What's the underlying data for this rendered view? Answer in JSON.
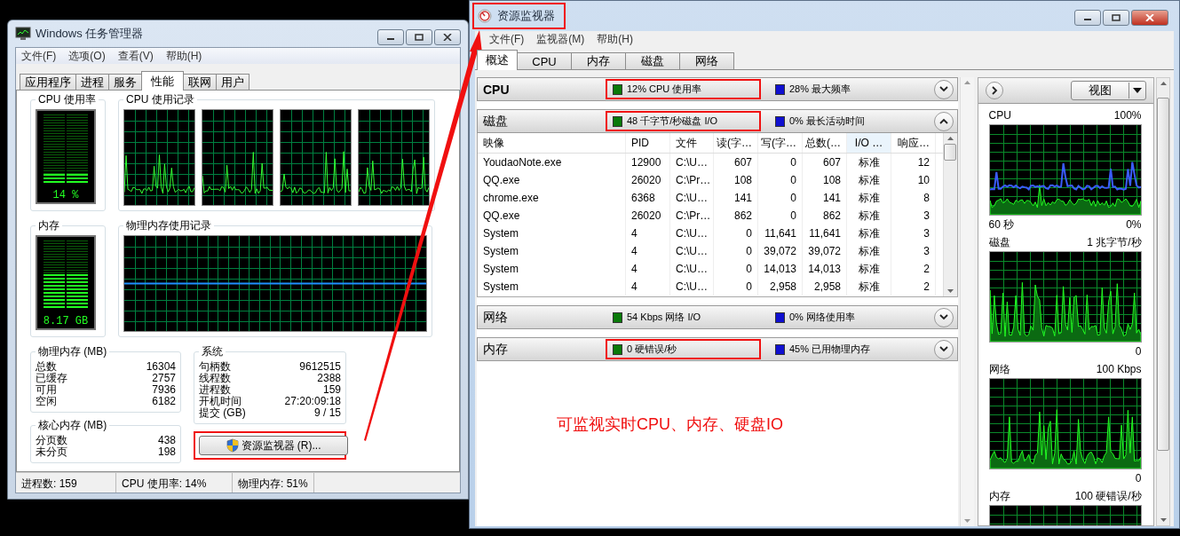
{
  "task_manager": {
    "title": "Windows 任务管理器",
    "menu": [
      "文件(F)",
      "选项(O)",
      "查看(V)",
      "帮助(H)"
    ],
    "tabs": [
      {
        "label": "应用程序",
        "selected": false
      },
      {
        "label": "进程",
        "selected": false
      },
      {
        "label": "服务",
        "selected": false
      },
      {
        "label": "性能",
        "selected": true
      },
      {
        "label": "联网",
        "selected": false
      },
      {
        "label": "用户",
        "selected": false
      }
    ],
    "cpu_usage": {
      "title": "CPU 使用率",
      "reading": "14 %",
      "level": 0.14
    },
    "cpu_history": {
      "title": "CPU 使用记录"
    },
    "memory": {
      "title": "内存",
      "reading": "8.17 GB",
      "level": 0.51
    },
    "memory_history": {
      "title": "物理内存使用记录"
    },
    "physical_memory": {
      "title": "物理内存 (MB)",
      "rows": [
        {
          "label": "总数",
          "value": "16304"
        },
        {
          "label": "已缓存",
          "value": "2757"
        },
        {
          "label": "可用",
          "value": "7936"
        },
        {
          "label": "空闲",
          "value": "6182"
        }
      ]
    },
    "kernel_memory": {
      "title": "核心内存 (MB)",
      "rows": [
        {
          "label": "分页数",
          "value": "438"
        },
        {
          "label": "未分页",
          "value": "198"
        }
      ]
    },
    "system": {
      "title": "系统",
      "rows": [
        {
          "label": "句柄数",
          "value": "9612515"
        },
        {
          "label": "线程数",
          "value": "2388"
        },
        {
          "label": "进程数",
          "value": "159"
        },
        {
          "label": "开机时间",
          "value": "27:20:09:18"
        },
        {
          "label": "提交 (GB)",
          "value": "9 / 15"
        }
      ]
    },
    "resource_button": {
      "label": "资源监视器 (R)...",
      "highlighted": true
    },
    "status_bar": [
      "进程数: 159",
      "CPU 使用率: 14%",
      "物理内存: 51%"
    ]
  },
  "resource_monitor": {
    "title": "资源监视器",
    "title_highlighted": true,
    "menu": [
      "文件(F)",
      "监视器(M)",
      "帮助(H)"
    ],
    "tabs": [
      {
        "label": "概述",
        "selected": true
      },
      {
        "label": "CPU",
        "selected": false
      },
      {
        "label": "内存",
        "selected": false
      },
      {
        "label": "磁盘",
        "selected": false
      },
      {
        "label": "网络",
        "selected": false
      }
    ],
    "sections": [
      {
        "name": "CPU",
        "expanded": false,
        "stats": [
          {
            "text": "12% CPU 使用率",
            "highlighted": true
          },
          {
            "text": "28% 最大频率",
            "highlighted": false
          }
        ]
      },
      {
        "name": "磁盘",
        "expanded": true,
        "stats": [
          {
            "text": "48 千字节/秒磁盘 I/O",
            "highlighted": true
          },
          {
            "text": "0% 最长活动时间",
            "highlighted": false
          }
        ],
        "table": {
          "columns": [
            "映像",
            "PID",
            "文件",
            "读(字…",
            "写(字…",
            "总数(…",
            "I/O …",
            "响应…"
          ],
          "rows": [
            [
              "YoudaoNote.exe",
              "12900",
              "C:\\U…",
              "607",
              "0",
              "607",
              "标准",
              "12"
            ],
            [
              "QQ.exe",
              "26020",
              "C:\\Pr…",
              "108",
              "0",
              "108",
              "标准",
              "10"
            ],
            [
              "chrome.exe",
              "6368",
              "C:\\U…",
              "141",
              "0",
              "141",
              "标准",
              "8"
            ],
            [
              "QQ.exe",
              "26020",
              "C:\\Pr…",
              "862",
              "0",
              "862",
              "标准",
              "3"
            ],
            [
              "System",
              "4",
              "C:\\U…",
              "0",
              "11,641",
              "11,641",
              "标准",
              "3"
            ],
            [
              "System",
              "4",
              "C:\\U…",
              "0",
              "39,072",
              "39,072",
              "标准",
              "3"
            ],
            [
              "System",
              "4",
              "C:\\U…",
              "0",
              "14,013",
              "14,013",
              "标准",
              "2"
            ],
            [
              "System",
              "4",
              "C:\\U…",
              "0",
              "2,958",
              "2,958",
              "标准",
              "2"
            ]
          ]
        }
      },
      {
        "name": "网络",
        "expanded": false,
        "stats": [
          {
            "text": "54 Kbps 网络 I/O",
            "highlighted": false
          },
          {
            "text": "0% 网络使用率",
            "highlighted": false
          }
        ]
      },
      {
        "name": "内存",
        "expanded": false,
        "stats": [
          {
            "text": "0 硬错误/秒",
            "highlighted": true
          },
          {
            "text": "45% 已用物理内存",
            "highlighted": false
          }
        ]
      }
    ],
    "view_button": "视图",
    "charts": [
      {
        "name": "CPU",
        "scale": "100%",
        "time": "60 秒",
        "floor": "0%"
      },
      {
        "name": "磁盘",
        "scale": "1 兆字节/秒",
        "floor": "0"
      },
      {
        "name": "网络",
        "scale": "100 Kbps",
        "floor": "0"
      },
      {
        "name": "内存",
        "scale": "100 硬错误/秒"
      }
    ]
  },
  "annotation": {
    "text": "可监视实时CPU、内存、硬盘IO"
  }
}
